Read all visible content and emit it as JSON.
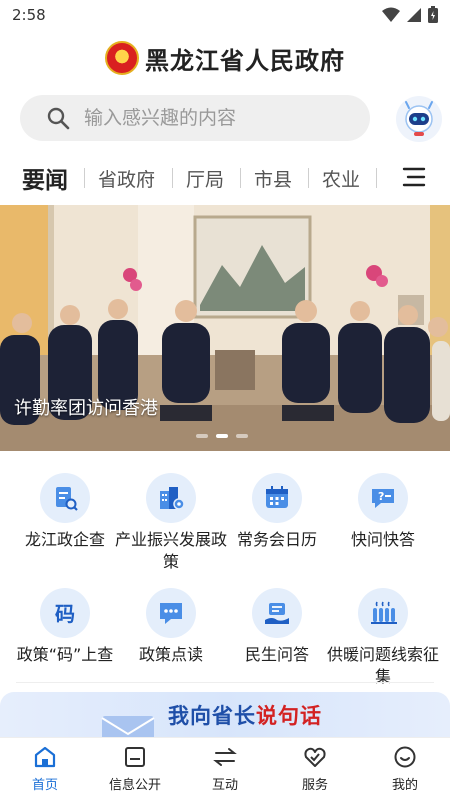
{
  "status_bar": {
    "time": "2:58"
  },
  "header": {
    "title": "黑龙江省人民政府"
  },
  "search": {
    "placeholder": "输入感兴趣的内容"
  },
  "tabs": [
    {
      "label": "要闻",
      "active": true
    },
    {
      "label": "省政府",
      "active": false
    },
    {
      "label": "厅局",
      "active": false
    },
    {
      "label": "市县",
      "active": false
    },
    {
      "label": "农业",
      "active": false
    }
  ],
  "banner": {
    "caption": "许勤率团访问香港",
    "slide_count": 3,
    "active_slide": 2
  },
  "services": [
    {
      "label": "龙江政企查",
      "icon": "document-search-icon"
    },
    {
      "label": "产业振兴发展政策",
      "icon": "industry-building-icon"
    },
    {
      "label": "常务会日历",
      "icon": "calendar-icon"
    },
    {
      "label": "快问快答",
      "icon": "chat-question-icon"
    },
    {
      "label": "政策“码”上查",
      "icon": "policy-code-icon"
    },
    {
      "label": "政策点读",
      "icon": "speech-bubble-icon"
    },
    {
      "label": "民生问答",
      "icon": "hand-heart-icon"
    },
    {
      "label": "供暖问题线索征集",
      "icon": "radiator-icon"
    }
  ],
  "promo": {
    "title_part1": "我向省长",
    "title_part2": "说句话"
  },
  "bottom_nav": [
    {
      "label": "首页",
      "icon": "home-icon",
      "active": true
    },
    {
      "label": "信息公开",
      "icon": "info-board-icon",
      "active": false
    },
    {
      "label": "互动",
      "icon": "exchange-arrows-icon",
      "active": false
    },
    {
      "label": "服务",
      "icon": "heart-hand-icon",
      "active": false
    },
    {
      "label": "我的",
      "icon": "smile-face-icon",
      "active": false
    }
  ],
  "colors": {
    "accent": "#1a6fd6",
    "icon_bg": "#e4eefb",
    "promo_blue": "#1f4fa8",
    "promo_red": "#d32222"
  }
}
